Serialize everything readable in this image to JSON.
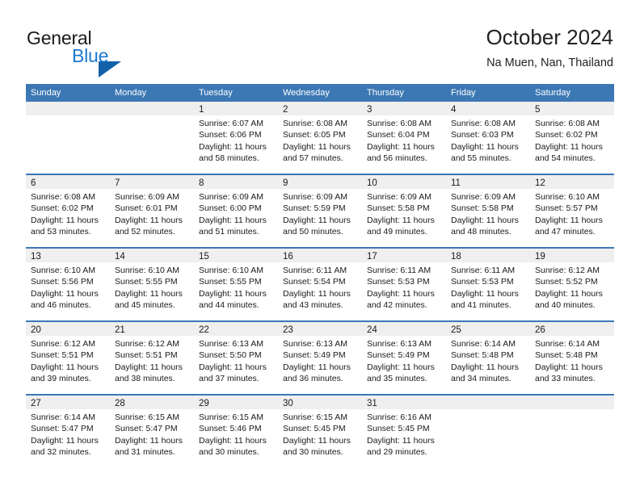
{
  "brand": {
    "name_part1": "General",
    "name_part2": "Blue",
    "triangle_color": "#1360a8",
    "blue_color": "#1a79d0"
  },
  "header": {
    "title": "October 2024",
    "subtitle": "Na Muen, Nan, Thailand"
  },
  "theme": {
    "header_row_bg": "#3c78b4",
    "header_row_text": "#ffffff",
    "day_number_band_bg": "#efefef",
    "separator_color": "#3c78b4",
    "body_text": "#1a1a1a"
  },
  "calendar": {
    "day_headers": [
      "Sunday",
      "Monday",
      "Tuesday",
      "Wednesday",
      "Thursday",
      "Friday",
      "Saturday"
    ],
    "weeks": [
      [
        {
          "day": "",
          "lines": []
        },
        {
          "day": "",
          "lines": []
        },
        {
          "day": "1",
          "lines": [
            "Sunrise: 6:07 AM",
            "Sunset: 6:06 PM",
            "Daylight: 11 hours and 58 minutes."
          ]
        },
        {
          "day": "2",
          "lines": [
            "Sunrise: 6:08 AM",
            "Sunset: 6:05 PM",
            "Daylight: 11 hours and 57 minutes."
          ]
        },
        {
          "day": "3",
          "lines": [
            "Sunrise: 6:08 AM",
            "Sunset: 6:04 PM",
            "Daylight: 11 hours and 56 minutes."
          ]
        },
        {
          "day": "4",
          "lines": [
            "Sunrise: 6:08 AM",
            "Sunset: 6:03 PM",
            "Daylight: 11 hours and 55 minutes."
          ]
        },
        {
          "day": "5",
          "lines": [
            "Sunrise: 6:08 AM",
            "Sunset: 6:02 PM",
            "Daylight: 11 hours and 54 minutes."
          ]
        }
      ],
      [
        {
          "day": "6",
          "lines": [
            "Sunrise: 6:08 AM",
            "Sunset: 6:02 PM",
            "Daylight: 11 hours and 53 minutes."
          ]
        },
        {
          "day": "7",
          "lines": [
            "Sunrise: 6:09 AM",
            "Sunset: 6:01 PM",
            "Daylight: 11 hours and 52 minutes."
          ]
        },
        {
          "day": "8",
          "lines": [
            "Sunrise: 6:09 AM",
            "Sunset: 6:00 PM",
            "Daylight: 11 hours and 51 minutes."
          ]
        },
        {
          "day": "9",
          "lines": [
            "Sunrise: 6:09 AM",
            "Sunset: 5:59 PM",
            "Daylight: 11 hours and 50 minutes."
          ]
        },
        {
          "day": "10",
          "lines": [
            "Sunrise: 6:09 AM",
            "Sunset: 5:58 PM",
            "Daylight: 11 hours and 49 minutes."
          ]
        },
        {
          "day": "11",
          "lines": [
            "Sunrise: 6:09 AM",
            "Sunset: 5:58 PM",
            "Daylight: 11 hours and 48 minutes."
          ]
        },
        {
          "day": "12",
          "lines": [
            "Sunrise: 6:10 AM",
            "Sunset: 5:57 PM",
            "Daylight: 11 hours and 47 minutes."
          ]
        }
      ],
      [
        {
          "day": "13",
          "lines": [
            "Sunrise: 6:10 AM",
            "Sunset: 5:56 PM",
            "Daylight: 11 hours and 46 minutes."
          ]
        },
        {
          "day": "14",
          "lines": [
            "Sunrise: 6:10 AM",
            "Sunset: 5:55 PM",
            "Daylight: 11 hours and 45 minutes."
          ]
        },
        {
          "day": "15",
          "lines": [
            "Sunrise: 6:10 AM",
            "Sunset: 5:55 PM",
            "Daylight: 11 hours and 44 minutes."
          ]
        },
        {
          "day": "16",
          "lines": [
            "Sunrise: 6:11 AM",
            "Sunset: 5:54 PM",
            "Daylight: 11 hours and 43 minutes."
          ]
        },
        {
          "day": "17",
          "lines": [
            "Sunrise: 6:11 AM",
            "Sunset: 5:53 PM",
            "Daylight: 11 hours and 42 minutes."
          ]
        },
        {
          "day": "18",
          "lines": [
            "Sunrise: 6:11 AM",
            "Sunset: 5:53 PM",
            "Daylight: 11 hours and 41 minutes."
          ]
        },
        {
          "day": "19",
          "lines": [
            "Sunrise: 6:12 AM",
            "Sunset: 5:52 PM",
            "Daylight: 11 hours and 40 minutes."
          ]
        }
      ],
      [
        {
          "day": "20",
          "lines": [
            "Sunrise: 6:12 AM",
            "Sunset: 5:51 PM",
            "Daylight: 11 hours and 39 minutes."
          ]
        },
        {
          "day": "21",
          "lines": [
            "Sunrise: 6:12 AM",
            "Sunset: 5:51 PM",
            "Daylight: 11 hours and 38 minutes."
          ]
        },
        {
          "day": "22",
          "lines": [
            "Sunrise: 6:13 AM",
            "Sunset: 5:50 PM",
            "Daylight: 11 hours and 37 minutes."
          ]
        },
        {
          "day": "23",
          "lines": [
            "Sunrise: 6:13 AM",
            "Sunset: 5:49 PM",
            "Daylight: 11 hours and 36 minutes."
          ]
        },
        {
          "day": "24",
          "lines": [
            "Sunrise: 6:13 AM",
            "Sunset: 5:49 PM",
            "Daylight: 11 hours and 35 minutes."
          ]
        },
        {
          "day": "25",
          "lines": [
            "Sunrise: 6:14 AM",
            "Sunset: 5:48 PM",
            "Daylight: 11 hours and 34 minutes."
          ]
        },
        {
          "day": "26",
          "lines": [
            "Sunrise: 6:14 AM",
            "Sunset: 5:48 PM",
            "Daylight: 11 hours and 33 minutes."
          ]
        }
      ],
      [
        {
          "day": "27",
          "lines": [
            "Sunrise: 6:14 AM",
            "Sunset: 5:47 PM",
            "Daylight: 11 hours and 32 minutes."
          ]
        },
        {
          "day": "28",
          "lines": [
            "Sunrise: 6:15 AM",
            "Sunset: 5:47 PM",
            "Daylight: 11 hours and 31 minutes."
          ]
        },
        {
          "day": "29",
          "lines": [
            "Sunrise: 6:15 AM",
            "Sunset: 5:46 PM",
            "Daylight: 11 hours and 30 minutes."
          ]
        },
        {
          "day": "30",
          "lines": [
            "Sunrise: 6:15 AM",
            "Sunset: 5:45 PM",
            "Daylight: 11 hours and 30 minutes."
          ]
        },
        {
          "day": "31",
          "lines": [
            "Sunrise: 6:16 AM",
            "Sunset: 5:45 PM",
            "Daylight: 11 hours and 29 minutes."
          ]
        },
        {
          "day": "",
          "lines": []
        },
        {
          "day": "",
          "lines": []
        }
      ]
    ]
  }
}
